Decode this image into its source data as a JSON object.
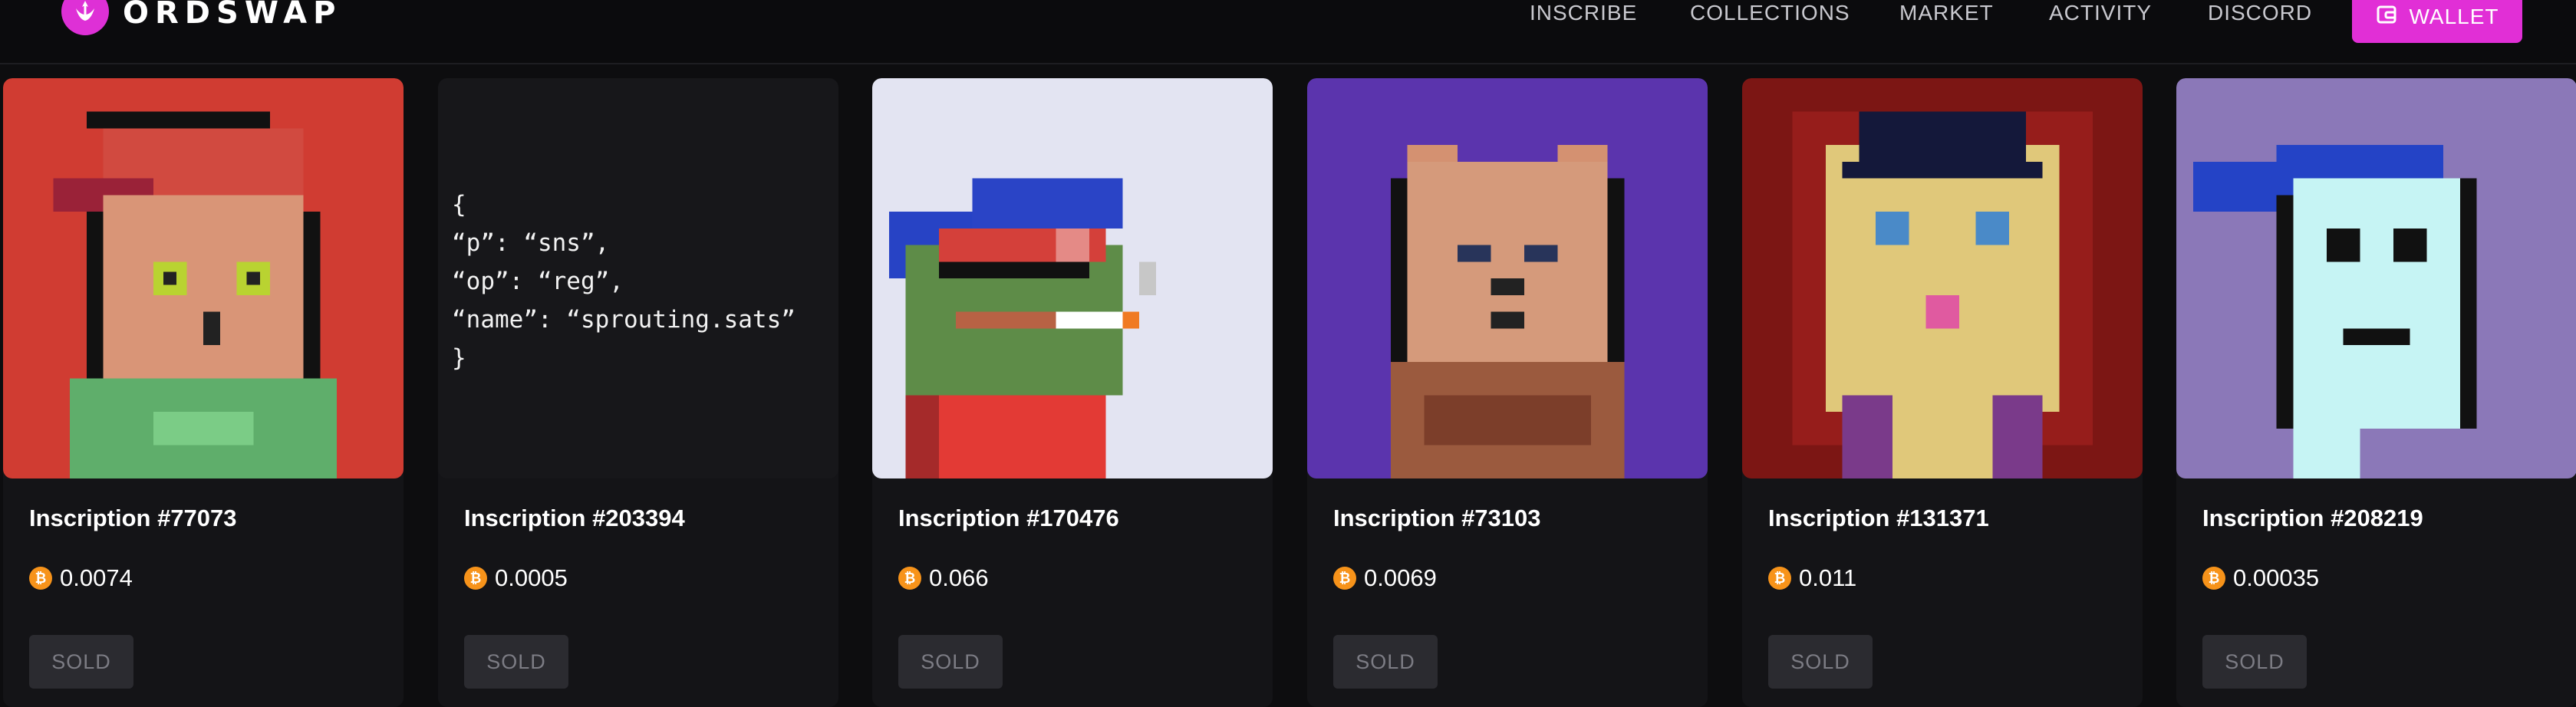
{
  "nav": {
    "brand": "ORDSWAP",
    "links": [
      "INSCRIBE",
      "COLLECTIONS",
      "MARKET",
      "ACTIVITY",
      "DISCORD"
    ],
    "wallet_label": "WALLET"
  },
  "colors": {
    "accent": "#e12fd6",
    "background": "#0d0d0f",
    "card": "#141417",
    "btc": "#f7931a"
  },
  "currency_icon": "bitcoin-icon",
  "cards": [
    {
      "title": "Inscription #77073",
      "price": "0.0074",
      "status": "SOLD"
    },
    {
      "title": "Inscription #203394",
      "price": "0.0005",
      "status": "SOLD",
      "json_lines": [
        "{",
        "“p”: “sns”,",
        "“op”: “reg”,",
        "“name”: “sprouting.sats”",
        "}"
      ]
    },
    {
      "title": "Inscription #170476",
      "price": "0.066",
      "status": "SOLD"
    },
    {
      "title": "Inscription #73103",
      "price": "0.0069",
      "status": "SOLD"
    },
    {
      "title": "Inscription #131371",
      "price": "0.011",
      "status": "SOLD"
    },
    {
      "title": "Inscription #208219",
      "price": "0.00035",
      "status": "SOLD"
    }
  ]
}
